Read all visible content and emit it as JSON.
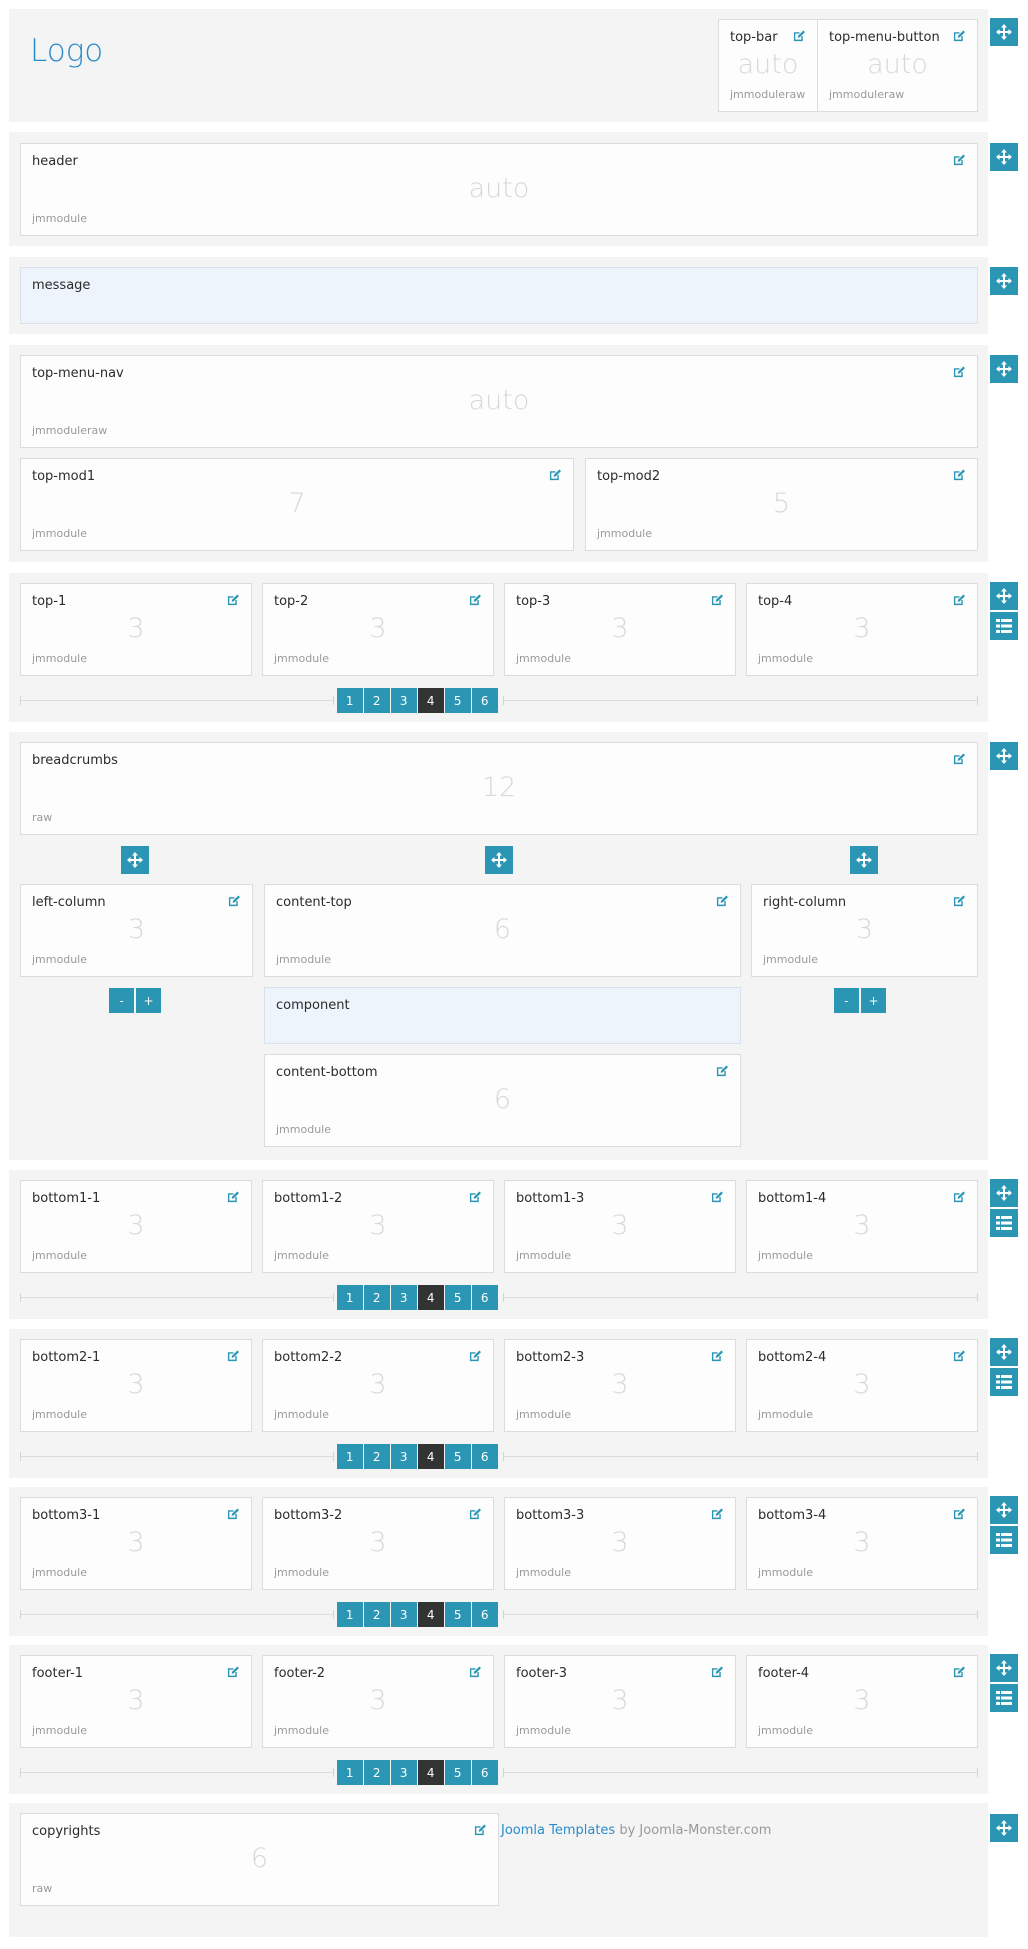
{
  "colors": {
    "accent": "#2b95b4",
    "active_page": "#333333",
    "logo": "#2a8cc8",
    "section_bg": "#f4f4f4",
    "highlight_block": "#edf4fc"
  },
  "logo": {
    "text": "Logo"
  },
  "top_bar": [
    {
      "name": "top-bar",
      "size": "auto",
      "type": "jmmoduleraw"
    },
    {
      "name": "top-menu-button",
      "size": "auto",
      "type": "jmmoduleraw"
    }
  ],
  "header": {
    "name": "header",
    "size": "auto",
    "type": "jmmodule"
  },
  "message": {
    "name": "message"
  },
  "top_menu_nav": {
    "name": "top-menu-nav",
    "size": "auto",
    "type": "jmmoduleraw"
  },
  "top_mods": [
    {
      "name": "top-mod1",
      "size": "7",
      "type": "jmmodule"
    },
    {
      "name": "top-mod2",
      "size": "5",
      "type": "jmmodule"
    }
  ],
  "pager_pages": [
    "1",
    "2",
    "3",
    "4",
    "5",
    "6"
  ],
  "pager_active": "4",
  "row_top": [
    {
      "name": "top-1",
      "size": "3",
      "type": "jmmodule"
    },
    {
      "name": "top-2",
      "size": "3",
      "type": "jmmodule"
    },
    {
      "name": "top-3",
      "size": "3",
      "type": "jmmodule"
    },
    {
      "name": "top-4",
      "size": "3",
      "type": "jmmodule"
    }
  ],
  "breadcrumbs": {
    "name": "breadcrumbs",
    "size": "12",
    "type": "raw"
  },
  "columns": {
    "left": {
      "name": "left-column",
      "size": "3",
      "type": "jmmodule"
    },
    "content_top": {
      "name": "content-top",
      "size": "6",
      "type": "jmmodule"
    },
    "right": {
      "name": "right-column",
      "size": "3",
      "type": "jmmodule"
    },
    "component": {
      "name": "component"
    },
    "content_bottom": {
      "name": "content-bottom",
      "size": "6",
      "type": "jmmodule"
    },
    "minus_label": "-",
    "plus_label": "+"
  },
  "row_bottom1": [
    {
      "name": "bottom1-1",
      "size": "3",
      "type": "jmmodule"
    },
    {
      "name": "bottom1-2",
      "size": "3",
      "type": "jmmodule"
    },
    {
      "name": "bottom1-3",
      "size": "3",
      "type": "jmmodule"
    },
    {
      "name": "bottom1-4",
      "size": "3",
      "type": "jmmodule"
    }
  ],
  "row_bottom2": [
    {
      "name": "bottom2-1",
      "size": "3",
      "type": "jmmodule"
    },
    {
      "name": "bottom2-2",
      "size": "3",
      "type": "jmmodule"
    },
    {
      "name": "bottom2-3",
      "size": "3",
      "type": "jmmodule"
    },
    {
      "name": "bottom2-4",
      "size": "3",
      "type": "jmmodule"
    }
  ],
  "row_bottom3": [
    {
      "name": "bottom3-1",
      "size": "3",
      "type": "jmmodule"
    },
    {
      "name": "bottom3-2",
      "size": "3",
      "type": "jmmodule"
    },
    {
      "name": "bottom3-3",
      "size": "3",
      "type": "jmmodule"
    },
    {
      "name": "bottom3-4",
      "size": "3",
      "type": "jmmodule"
    }
  ],
  "row_footer": [
    {
      "name": "footer-1",
      "size": "3",
      "type": "jmmodule"
    },
    {
      "name": "footer-2",
      "size": "3",
      "type": "jmmodule"
    },
    {
      "name": "footer-3",
      "size": "3",
      "type": "jmmodule"
    },
    {
      "name": "footer-4",
      "size": "3",
      "type": "jmmodule"
    }
  ],
  "copyrights": {
    "name": "copyrights",
    "size": "6",
    "type": "raw"
  },
  "credit": {
    "link_text": "Joomla Templates",
    "rest_text": " by Joomla-Monster.com"
  },
  "icons": {
    "edit": "edit-icon",
    "move": "move-icon",
    "list": "list-icon"
  }
}
